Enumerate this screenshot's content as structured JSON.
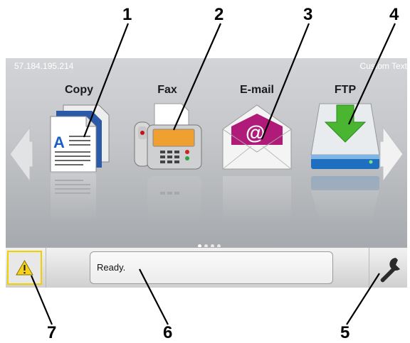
{
  "callouts": [
    "1",
    "2",
    "3",
    "4",
    "5",
    "6",
    "7"
  ],
  "header": {
    "ip_address": "57.184.195.214",
    "custom_text": "Custom Text"
  },
  "apps": [
    {
      "label": "Copy",
      "icon": "copy-icon"
    },
    {
      "label": "Fax",
      "icon": "fax-icon"
    },
    {
      "label": "E-mail",
      "icon": "email-icon"
    },
    {
      "label": "FTP",
      "icon": "ftp-icon"
    }
  ],
  "status_bar": {
    "message": "Ready.",
    "warning_icon": "warning-icon",
    "settings_icon": "wrench-icon",
    "warning_border_color": "#f2d000"
  },
  "pagination": {
    "pages": 4,
    "current": 1
  }
}
